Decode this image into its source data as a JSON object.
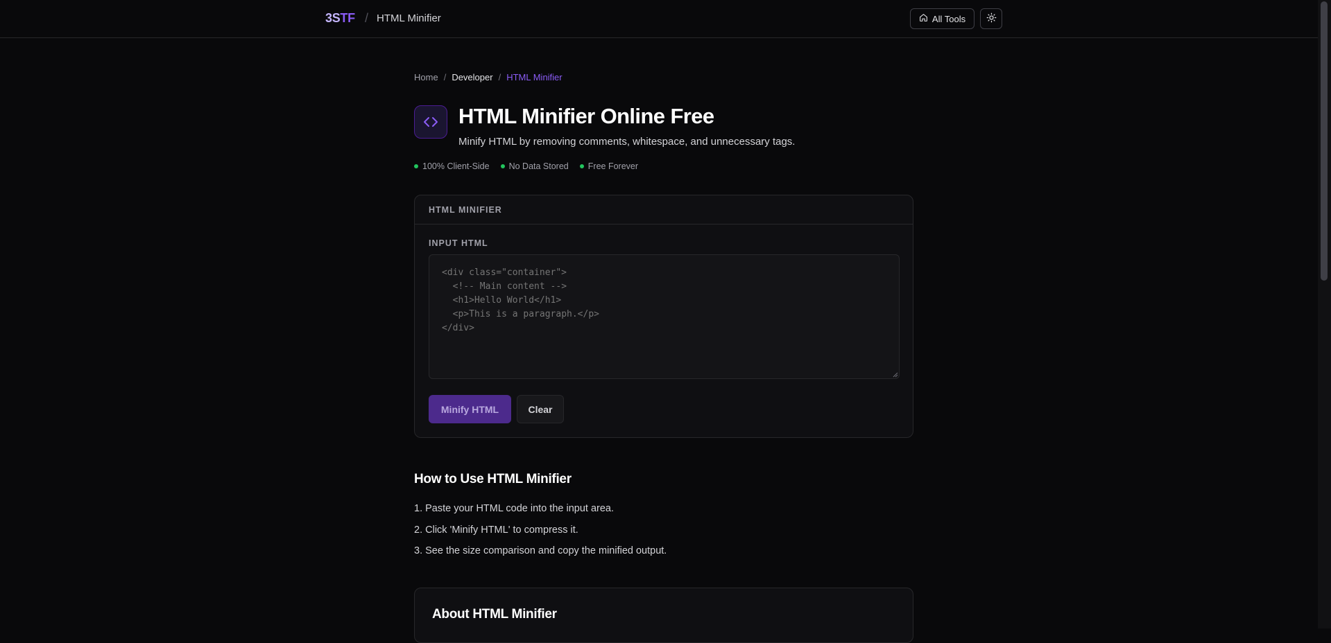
{
  "header": {
    "brand_part1": "3S",
    "brand_part2": "TF",
    "separator": "/",
    "page_name": "HTML Minifier",
    "all_tools_label": "All Tools"
  },
  "breadcrumb": {
    "home": "Home",
    "separator": "/",
    "section": "Developer",
    "current": "HTML Minifier"
  },
  "hero": {
    "icon": "code-brackets-icon",
    "title": "HTML Minifier Online Free",
    "subtitle": "Minify HTML by removing comments, whitespace, and unnecessary tags."
  },
  "badges": [
    "100% Client-Side",
    "No Data Stored",
    "Free Forever"
  ],
  "tool": {
    "card_title": "HTML MINIFIER",
    "input_label": "INPUT HTML",
    "input_placeholder": "<div class=\"container\">\n  <!-- Main content -->\n  <h1>Hello World</h1>\n  <p>This is a paragraph.</p>\n</div>",
    "minify_label": "Minify HTML",
    "clear_label": "Clear"
  },
  "how_to": {
    "title": "How to Use HTML Minifier",
    "steps": [
      "1. Paste your HTML code into the input area.",
      "2. Click 'Minify HTML' to compress it.",
      "3. See the size comparison and copy the minified output."
    ]
  },
  "about": {
    "title": "About HTML Minifier"
  },
  "colors": {
    "accent": "#8b5cf6",
    "background": "#09090b",
    "success": "#22c55e"
  }
}
